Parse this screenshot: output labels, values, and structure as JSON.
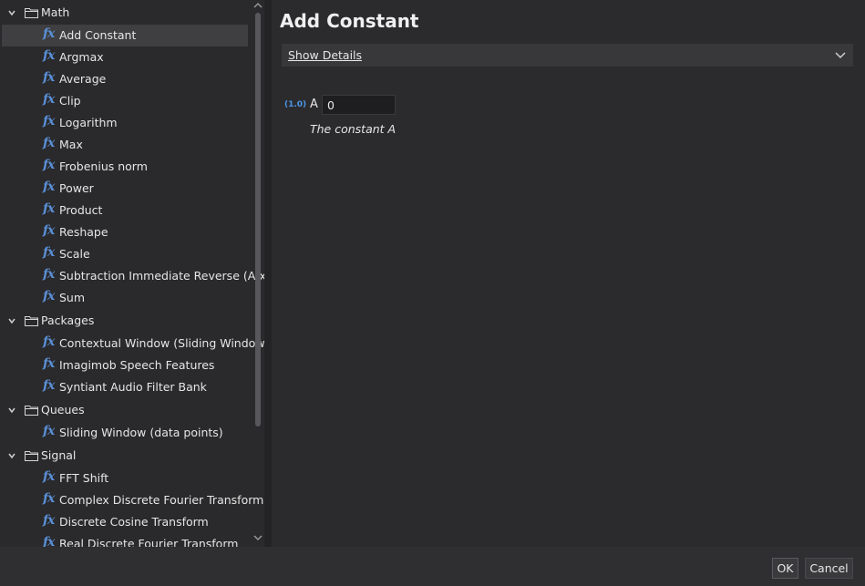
{
  "tree": {
    "groups": [
      {
        "label": "Math",
        "items": [
          "Add Constant",
          "Argmax",
          "Average",
          "Clip",
          "Logarithm",
          "Max",
          "Frobenius norm",
          "Power",
          "Product",
          "Reshape",
          "Scale",
          "Subtraction Immediate Reverse (A-x)",
          "Sum"
        ]
      },
      {
        "label": "Packages",
        "items": [
          "Contextual Window (Sliding Window)",
          "Imagimob Speech Features",
          "Syntiant Audio Filter Bank"
        ]
      },
      {
        "label": "Queues",
        "items": [
          "Sliding Window (data points)"
        ]
      },
      {
        "label": "Signal",
        "items": [
          "FFT Shift",
          "Complex Discrete Fourier Transform",
          "Discrete Cosine Transform",
          "Real Discrete Fourier Transform"
        ]
      }
    ],
    "selected_item": "Add Constant",
    "item_icon": "fx",
    "folder_icon": "folder-icon"
  },
  "detail": {
    "title": "Add Constant",
    "show_details_label": "Show Details",
    "param": {
      "type_hint": "(1.0)",
      "name": "A",
      "value": "0",
      "description": "The constant A"
    }
  },
  "footer": {
    "ok_label": "OK",
    "cancel_label": "Cancel"
  },
  "colors": {
    "accent_icon": "#5a8fd6",
    "selected_row": "#3f3f42"
  }
}
